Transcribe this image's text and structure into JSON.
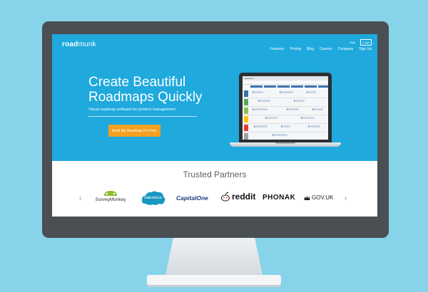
{
  "header": {
    "logo_bold": "road",
    "logo_regular": "munk",
    "help": "Help",
    "login": "Login",
    "nav": [
      "Features",
      "Pricing",
      "Blog",
      "Careers",
      "Company",
      "Sign Up"
    ]
  },
  "hero": {
    "title_line1": "Create Beautiful",
    "title_line2": "Roadmaps Quickly",
    "subtitle": "Visual roadmap software for product management",
    "cta_label": "Build My Roadmap For Free"
  },
  "laptop": {
    "app_title": "roadmunk"
  },
  "partners": {
    "title": "Trusted Partners",
    "logos": [
      "SurveyMonkey",
      "salesforce",
      "CapitalOne",
      "reddit",
      "PHONAK",
      "GOV.UK"
    ]
  },
  "colors": {
    "background": "#86d3ea",
    "hero": "#1fa9dd",
    "cta": "#f4a020",
    "bezel": "#4a4f53"
  }
}
